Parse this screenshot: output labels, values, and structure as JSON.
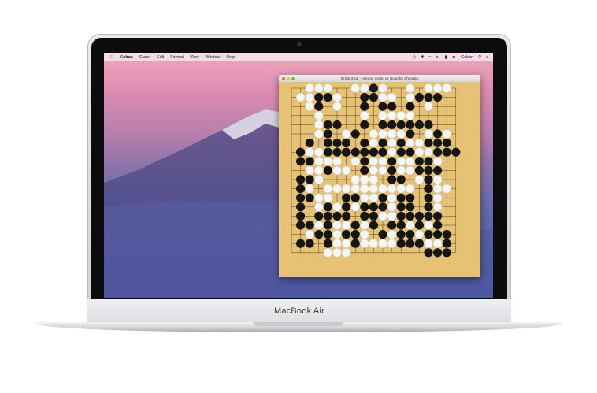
{
  "device": {
    "brand": "MacBook Air"
  },
  "menubar": {
    "apple_icon": "apple-icon",
    "items": [
      "Goban",
      "Game",
      "Edit",
      "Format",
      "View",
      "Window",
      "Help"
    ],
    "status_icons": [
      "clock-icon",
      "bluetooth-icon",
      "wifi-icon",
      "volume-icon",
      "battery-icon",
      "user-icon"
    ],
    "app_label": "Goban",
    "right_icons": [
      "search-icon",
      "list-icon"
    ]
  },
  "window": {
    "title": "Brilliant.sgf – Genan Inseki vs Honinbo Shusaku",
    "colors": {
      "board": "#e6c274",
      "black_stone": "#151515",
      "white_stone": "#f6f6f6"
    }
  },
  "board": {
    "size": 19,
    "rows": [
      "..WWW..WWBW..W.WWW.",
      ".WWBBW..BBWW.WBBB..",
      "..WB.W..B.BB.B.W...",
      "...W....W.WWWW.....",
      "...WBB..B.BBBBBB...",
      "...WB.WB.WWWWB.WBW.",
      "..B.BBB.BWBWBWWBBB.",
      ".BWWBBBBBBBWBBWWBBB",
      ".BBWWW.WBWWBWWBBW..",
      "..WWBWW.BWWBWWBBB..",
      ".BBW...WWW.BB.WBW..",
      ".BW.WWWWWWWWWW.BWW.",
      ".BBWW.BBWWBWBB.BW..",
      ".B.WBWBWBBBWBB.BW..",
      ".B.BBBB.BBWWBBBBB..",
      ".BBWBWWBWB.BBWBWB..",
      "..WBBWBBW.BWBBWBBB.",
      ".BB.BWWBWWWWBBBWWB.",
      "....WWW........BBB."
    ]
  }
}
